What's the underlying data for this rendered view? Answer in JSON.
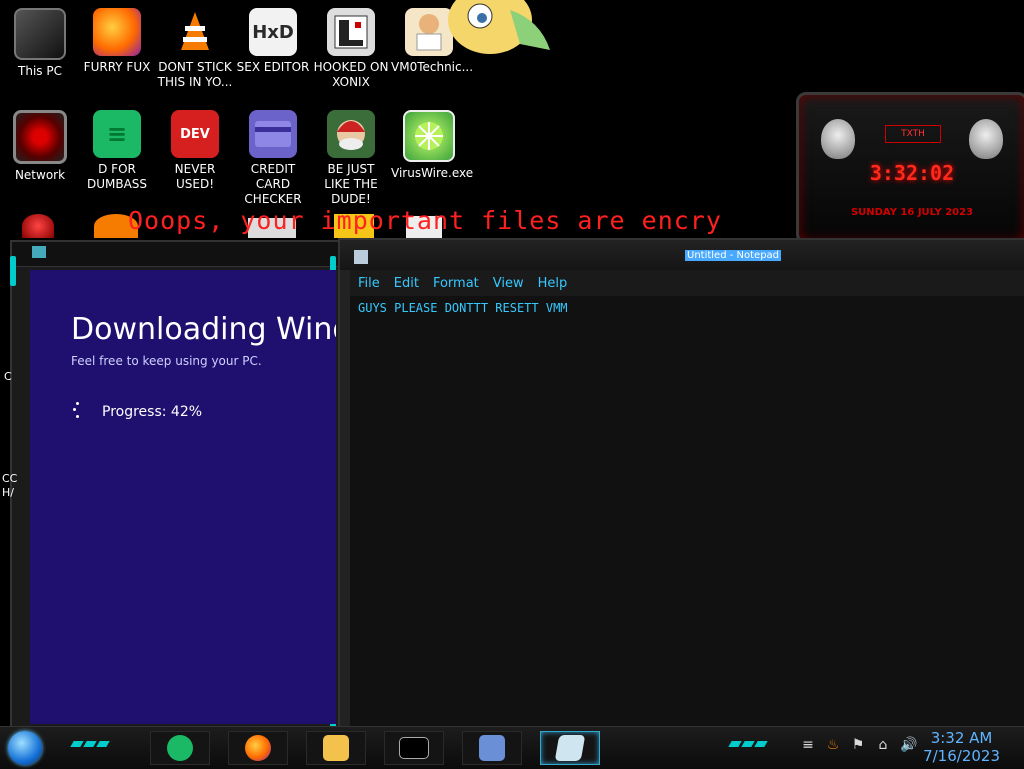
{
  "desktop": {
    "icons": [
      {
        "label": "This PC",
        "glyph": ""
      },
      {
        "label": "FURRY FUX",
        "glyph": ""
      },
      {
        "label": "DONT STICK THIS IN YO...",
        "glyph": "▲"
      },
      {
        "label": "SEX EDITOR",
        "glyph": "HxD"
      },
      {
        "label": "HOOKED ON XONIX",
        "glyph": ""
      },
      {
        "label": "VM0Technic...",
        "glyph": ""
      },
      {
        "label": "Network",
        "glyph": ""
      },
      {
        "label": "D FOR DUMBASS",
        "glyph": "≡"
      },
      {
        "label": "NEVER USED!",
        "glyph": "DEV"
      },
      {
        "label": "CREDIT CARD CHECKER",
        "glyph": ""
      },
      {
        "label": "BE JUST LIKE THE DUDE!",
        "glyph": ""
      },
      {
        "label": "VirusWire.exe",
        "glyph": ""
      }
    ],
    "ransom_text": "Ooops, your important files are encry"
  },
  "gadget": {
    "title": "TXTH",
    "time": "3:32:02",
    "date": "SUNDAY 16 JULY 2023"
  },
  "installer": {
    "heading": "Downloading Windo",
    "subtext": "Feel free to keep using your PC.",
    "progress_label": "Progress: 42%",
    "progress_value": 0.42
  },
  "notepad": {
    "title": "Untitled - Notepad",
    "menu": [
      "File",
      "Edit",
      "Format",
      "View",
      "Help"
    ],
    "text": "GUYS PLEASE DONTTT RESETT VMM"
  },
  "taskbar": {
    "apps": [
      "notes-app",
      "firefox",
      "file-explorer",
      "command-prompt",
      "installer",
      "notepad"
    ],
    "time": "3:32 AM",
    "date": "7/16/2023"
  },
  "colors": {
    "installer_bg": "#1f0f6f",
    "accent_cyan": "#36c9ff",
    "ransom_red": "#ff2020"
  }
}
